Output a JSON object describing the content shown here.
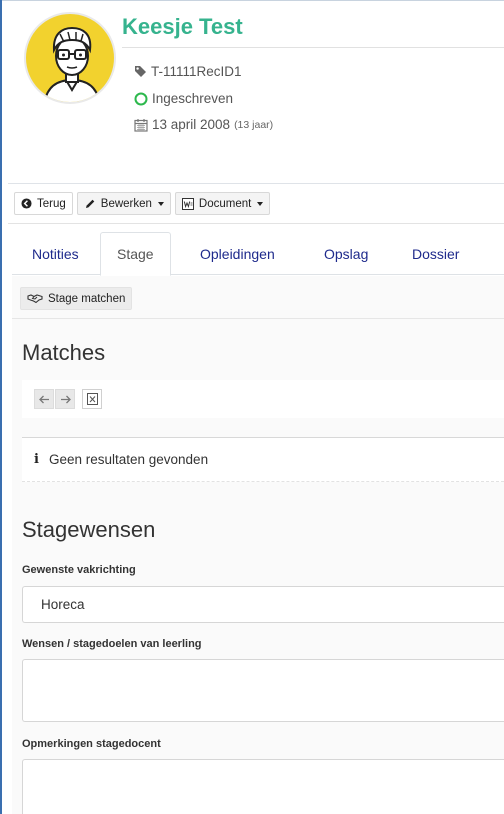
{
  "profile": {
    "name": "Keesje Test",
    "id": "T-11111RecID1",
    "status": "Ingeschreven",
    "birth_date": "13 april 2008",
    "age": "(13 jaar)",
    "status_color": "#2db84d",
    "name_color": "#36b38e"
  },
  "toolbar": {
    "back_label": "Terug",
    "edit_label": "Bewerken",
    "document_label": "Document"
  },
  "tabs": [
    {
      "label": "Notities",
      "active": false
    },
    {
      "label": "Stage",
      "active": true
    },
    {
      "label": "Opleidingen",
      "active": false
    },
    {
      "label": "Opslag",
      "active": false
    },
    {
      "label": "Dossier",
      "active": false
    }
  ],
  "stage": {
    "match_button_label": "Stage matchen",
    "matches_heading": "Matches",
    "empty_message": "Geen resultaten gevonden",
    "wensen_heading": "Stagewensen",
    "fields": {
      "vakrichting_label": "Gewenste vakrichting",
      "vakrichting_value": "Horeca",
      "wensen_label": "Wensen / stagedoelen van leerling",
      "wensen_value": "",
      "opmerkingen_label": "Opmerkingen stagedocent",
      "opmerkingen_value": ""
    }
  },
  "icons": {
    "id": "tag-icon",
    "status": "circle-outline-icon",
    "date": "calendar-icon",
    "back": "arrow-circle-left-icon",
    "edit": "pencil-icon",
    "document": "word-document-icon",
    "match": "handshake-icon",
    "prev": "arrow-left-icon",
    "next": "arrow-right-icon",
    "export": "excel-icon",
    "info": "info-icon"
  }
}
